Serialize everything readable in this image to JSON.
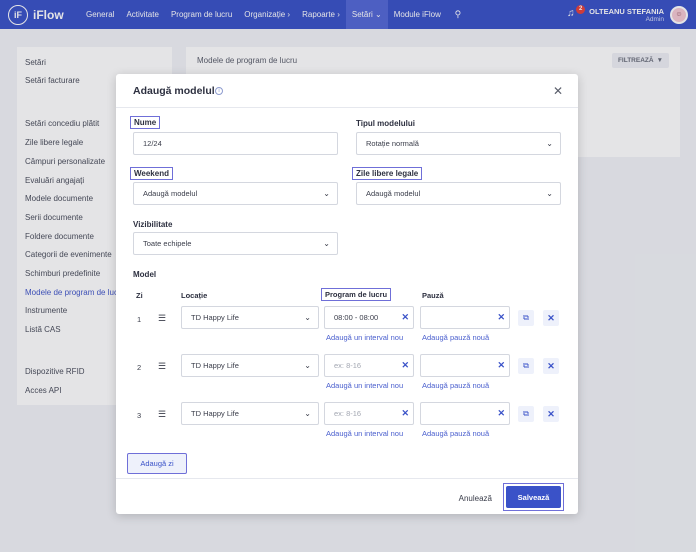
{
  "nav": {
    "logo_mark": "iF",
    "logo_text": "iFlow",
    "items": [
      "General",
      "Activitate",
      "Program de lucru",
      "Organizație ›",
      "Rapoarte ›",
      "Setări ⌄",
      "Module iFlow"
    ],
    "active_index": 5,
    "notifications_count": "2",
    "user_name": "OLTEANU STEFANIA",
    "user_role": "Admin"
  },
  "sidebar": {
    "items": [
      "Setări",
      "Setări facturare",
      "Setări concediu plătit",
      "Zile libere legale",
      "Câmpuri personalizate",
      "Evaluări angajați",
      "Modele documente",
      "Serii documente",
      "Foldere documente",
      "Categorii de evenimente",
      "Schimburi predefinite",
      "Modele de program de lucru",
      "Instrumente",
      "Listă CAS",
      "Dispozitive RFID",
      "Acces API"
    ],
    "active_index": 11
  },
  "panel": {
    "title": "Modele de program de lucru",
    "filter_label": "FILTREAZĂ"
  },
  "modal": {
    "title": "Adaugă modelul",
    "name_label": "Nume",
    "name_value": "12/24",
    "model_type_label": "Tipul modelului",
    "model_type_value": "Rotație normală",
    "weekend_label": "Weekend",
    "weekend_value": "Adaugă modelul",
    "holidays_label": "Zile libere legale",
    "holidays_value": "Adaugă modelul",
    "visibility_label": "Vizibilitate",
    "visibility_value": "Toate echipele",
    "model_section_label": "Model",
    "columns": {
      "day": "Zi",
      "location": "Locație",
      "schedule": "Program de lucru",
      "break": "Pauză"
    },
    "rows": [
      {
        "day": "1",
        "location": "TD Happy Life",
        "schedule": "08:00 - 08:00",
        "schedule_placeholder": "",
        "break": ""
      },
      {
        "day": "2",
        "location": "TD Happy Life",
        "schedule": "",
        "schedule_placeholder": "ex: 8-16",
        "break": ""
      },
      {
        "day": "3",
        "location": "TD Happy Life",
        "schedule": "",
        "schedule_placeholder": "ex: 8-16",
        "break": ""
      }
    ],
    "add_interval_label": "Adaugă un interval nou",
    "add_break_label": "Adaugă pauză nouă",
    "add_day_label": "Adaugă zi",
    "cancel_label": "Anulează",
    "save_label": "Salvează"
  }
}
